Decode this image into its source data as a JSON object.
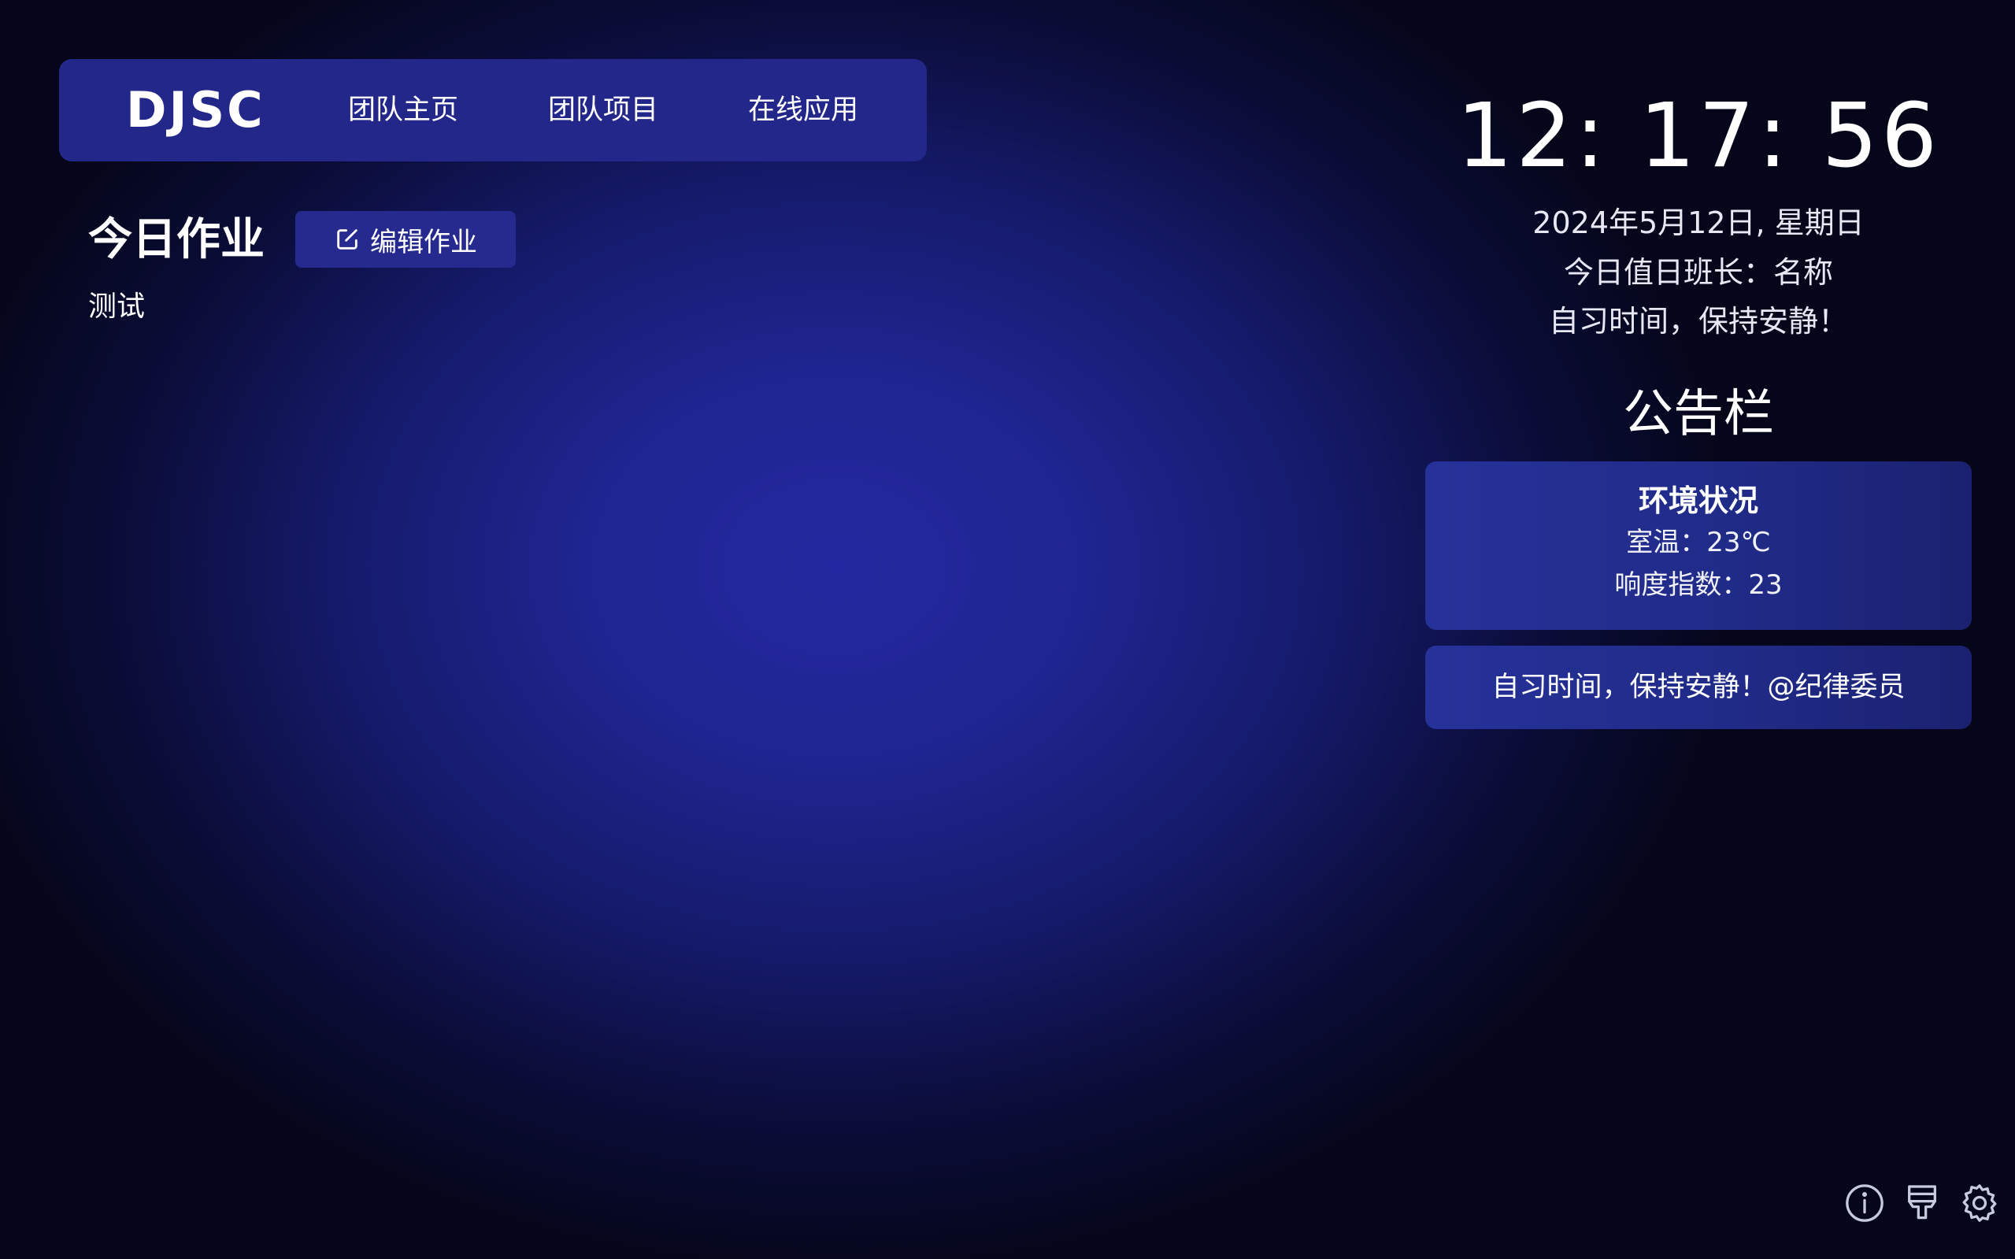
{
  "nav": {
    "logo": "DJSC",
    "links": [
      "团队主页",
      "团队项目",
      "在线应用"
    ]
  },
  "homework": {
    "title": "今日作业",
    "edit_label": "编辑作业",
    "content": "测试"
  },
  "clock": {
    "time": "12: 17: 56",
    "date": "2024年5月12日, 星期日",
    "monitor": "今日值日班长：名称",
    "quiet": "自习时间，保持安静！"
  },
  "board": {
    "title": "公告栏",
    "env": {
      "title": "环境状况",
      "temperature": "室温：23℃",
      "noise": "响度指数：23"
    },
    "notice": "自习时间，保持安静！@纪律委员"
  },
  "icons": [
    "info-icon",
    "brush-icon",
    "gear-icon"
  ],
  "colors": {
    "nav_bg": "#24278a",
    "background_center": "#2428a0",
    "background_edge": "#05061a",
    "card_bg": "#26329a"
  }
}
